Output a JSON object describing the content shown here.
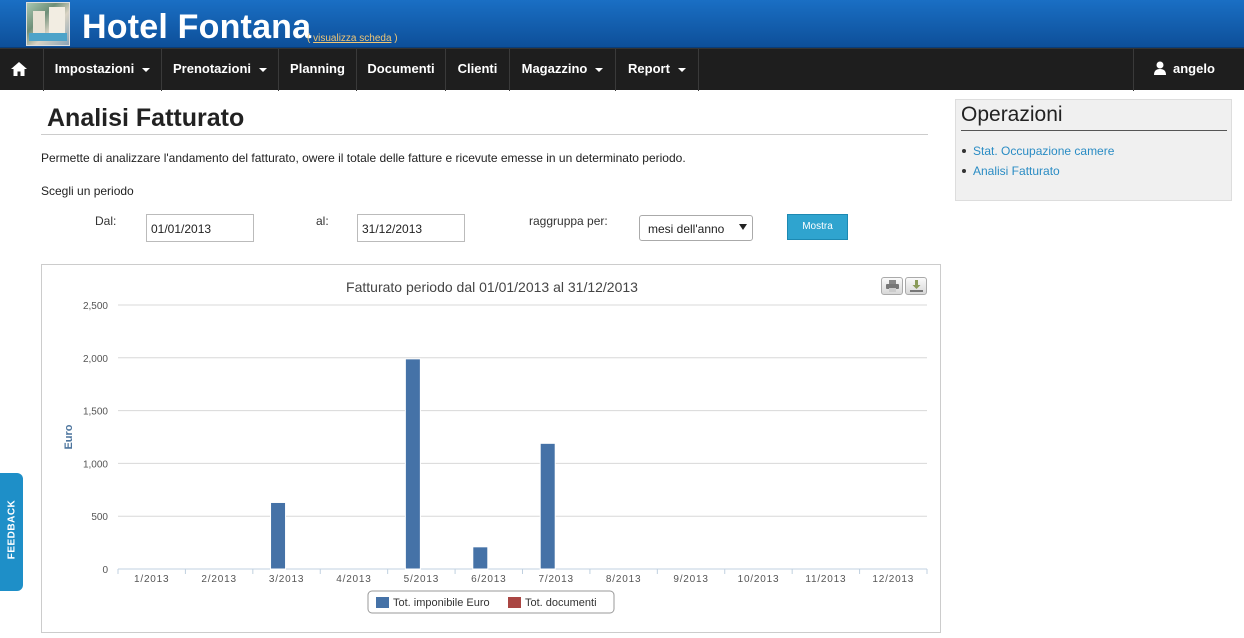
{
  "header": {
    "app_title": "Hotel Fontana",
    "view_link_open": "(",
    "view_link": "visualizza scheda",
    "view_link_close": ")"
  },
  "nav": {
    "home_icon": "home-icon",
    "items": [
      {
        "label": "Impostazioni",
        "dropdown": true
      },
      {
        "label": "Prenotazioni",
        "dropdown": true
      },
      {
        "label": "Planning",
        "dropdown": false
      },
      {
        "label": "Documenti",
        "dropdown": false
      },
      {
        "label": "Clienti",
        "dropdown": false
      },
      {
        "label": "Magazzino",
        "dropdown": true
      },
      {
        "label": "Report",
        "dropdown": true
      }
    ],
    "user": "angelo",
    "user_icon": "user-icon"
  },
  "main": {
    "title": "Analisi Fatturato",
    "description": "Permette di analizzare l'andamento del fatturato, owere il totale delle fatture e ricevute emesse in un determinato periodo.",
    "period_label": "Scegli un periodo",
    "from_label": "Dal:",
    "from_value": "01/01/2013",
    "to_label": "al:",
    "to_value": "31/12/2013",
    "group_label": "raggruppa per:",
    "group_value": "mesi dell'anno",
    "show_button": "Mostra"
  },
  "sidebar": {
    "title": "Operazioni",
    "links": [
      "Stat. Occupazione camere",
      "Analisi Fatturato"
    ]
  },
  "feedback": "FEEDBACK",
  "colors": {
    "header": "#1565b8",
    "navbar": "#1e1e1e",
    "link": "#2a8cc4",
    "series_1": "#4572a7",
    "series_2": "#aa4643",
    "button": "#2fa4cf"
  },
  "chart_data": {
    "type": "bar",
    "title": "Fatturato periodo dal 01/01/2013 al 31/12/2013",
    "ylabel": "Euro",
    "xlabel": "",
    "ylim": [
      0,
      2500
    ],
    "yticks": [
      "0",
      "500",
      "1,000",
      "1,500",
      "2,000",
      "2,500"
    ],
    "grid": true,
    "legend_position": "bottom",
    "categories": [
      "1/2013",
      "2/2013",
      "3/2013",
      "4/2013",
      "5/2013",
      "6/2013",
      "7/2013",
      "8/2013",
      "9/2013",
      "10/2013",
      "11/2013",
      "12/2013"
    ],
    "series": [
      {
        "name": "Tot. imponibile Euro",
        "color": "#4572a7",
        "values": [
          0,
          0,
          630,
          0,
          1990,
          210,
          1190,
          0,
          0,
          0,
          0,
          0
        ]
      },
      {
        "name": "Tot. documenti",
        "color": "#aa4643",
        "values": [
          0,
          0,
          0,
          0,
          0,
          0,
          0,
          0,
          0,
          0,
          0,
          0
        ]
      }
    ]
  }
}
